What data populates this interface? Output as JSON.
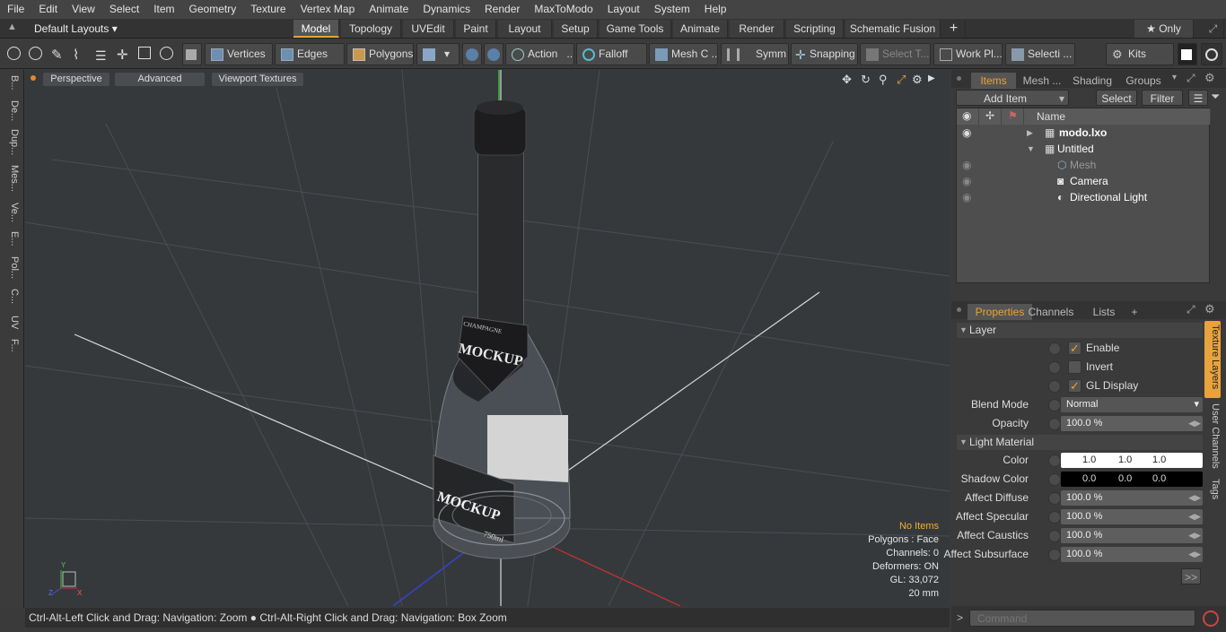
{
  "menu": [
    "File",
    "Edit",
    "View",
    "Select",
    "Item",
    "Geometry",
    "Texture",
    "Vertex Map",
    "Animate",
    "Dynamics",
    "Render",
    "MaxToModo",
    "Layout",
    "System",
    "Help"
  ],
  "layout_selector": "Default Layouts ▾",
  "layout_tabs": [
    "Model",
    "Topology",
    "UVEdit",
    "Paint",
    "Layout",
    "Setup",
    "Game Tools",
    "Animate",
    "Render",
    "Scripting",
    "Schematic Fusion",
    "+"
  ],
  "only_label": "★ Only",
  "toolbar": {
    "vertices": "Vertices",
    "edges": "Edges",
    "polygons": "Polygons",
    "action": "Action",
    "falloff": "Falloff",
    "mesh": "Mesh C ...",
    "symmetry": "Symm ...",
    "snapping": "Snapping",
    "select_t": "Select T...",
    "work_plane": "Work Pl...",
    "selection": "Selecti ...",
    "kits": "Kits"
  },
  "left_tabs": [
    "B...",
    "De...",
    "Dup...",
    "Mes...",
    "Ve...",
    "E...",
    "Pol...",
    "C...",
    "UV",
    "F..."
  ],
  "viewport": {
    "view_mode": "Perspective",
    "advanced": "Advanced",
    "textures": "Viewport Textures",
    "stats": {
      "items": "No Items",
      "polygons": "Polygons : Face",
      "channels": "Channels: 0",
      "deformers": "Deformers: ON",
      "gl": "GL: 33,072",
      "scale": "20 mm"
    },
    "label_brand": "MOCKUP",
    "label_brand2": "MOCKUP",
    "label_small": "CHAMPAGNE",
    "volume": "750ml"
  },
  "status": "Ctrl-Alt-Left Click and Drag: Navigation: Zoom ● Ctrl-Alt-Right Click and Drag: Navigation: Box Zoom",
  "items_panel": {
    "tabs": [
      "Items",
      "Mesh ...",
      "Shading",
      "Groups"
    ],
    "add_item": "Add Item",
    "select": "Select",
    "filter": "Filter",
    "name_col": "Name",
    "rows": [
      "modo.lxo",
      "Untitled",
      "Mesh",
      "Camera",
      "Directional Light"
    ]
  },
  "properties": {
    "tabs": [
      "Properties",
      "Channels",
      "Lists",
      "+"
    ],
    "layer_section": "Layer",
    "enable": "Enable",
    "invert": "Invert",
    "gl_display": "GL Display",
    "blend_mode_label": "Blend Mode",
    "blend_mode": "Normal",
    "opacity_label": "Opacity",
    "opacity": "100.0 %",
    "light_section": "Light Material",
    "color_label": "Color",
    "color": [
      "1.0",
      "1.0",
      "1.0"
    ],
    "shadow_label": "Shadow Color",
    "shadow": [
      "0.0",
      "0.0",
      "0.0"
    ],
    "diffuse_label": "Affect Diffuse",
    "diffuse": "100.0 %",
    "specular_label": "Affect Specular",
    "specular": "100.0 %",
    "caustics_label": "Affect Caustics",
    "caustics": "100.0 %",
    "subsurface_label": "Affect Subsurface",
    "subsurface": "100.0 %",
    "more": ">>",
    "side_tabs": [
      "Texture Layers",
      "User Channels",
      "Tags"
    ]
  },
  "command_placeholder": "Command",
  "colors": {
    "accent": "#e8a33c",
    "viewport_bg": "#36393c"
  }
}
